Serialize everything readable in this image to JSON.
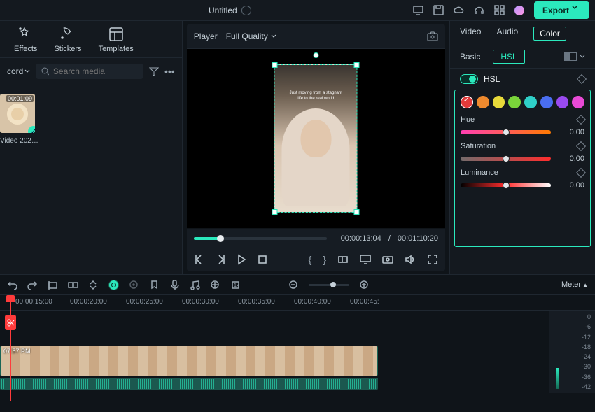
{
  "titlebar": {
    "title": "Untitled",
    "export": "Export"
  },
  "tools": {
    "effects": "Effects",
    "stickers": "Stickers",
    "templates": "Templates"
  },
  "search": {
    "record": "cord",
    "placeholder": "Search media"
  },
  "media": {
    "clip_duration": "00:01:09",
    "clip_name": "Video 202…"
  },
  "preview": {
    "player": "Player",
    "quality": "Full Quality",
    "caption1": "Just moving from a stagnant",
    "caption2": "life to the real world",
    "current": "00:00:13:04",
    "sep": "/",
    "total": "00:01:10:20"
  },
  "inspector": {
    "tab_video": "Video",
    "tab_audio": "Audio",
    "tab_color": "Color",
    "sub_basic": "Basic",
    "sub_hsl": "HSL",
    "hsl_toggle_label": "HSL",
    "hue": {
      "label": "Hue",
      "value": "0.00"
    },
    "saturation": {
      "label": "Saturation",
      "value": "0.00"
    },
    "luminance": {
      "label": "Luminance",
      "value": "0.00"
    },
    "swatch_colors": [
      "#e03a3a",
      "#ef8a2e",
      "#e8da3a",
      "#7ad43a",
      "#2fd0c8",
      "#4a6ef0",
      "#9a4af0",
      "#e84ad6"
    ]
  },
  "timeline": {
    "meter": "Meter",
    "marks": [
      "00:00:15:00",
      "00:00:20:00",
      "00:00:25:00",
      "00:00:30:00",
      "00:00:35:00",
      "00:00:40:00",
      "00:00:45:"
    ],
    "clip_label": "07:57 PM",
    "db": [
      "0",
      "-6",
      "-12",
      "-18",
      "-24",
      "-30",
      "-36",
      "-42"
    ]
  }
}
